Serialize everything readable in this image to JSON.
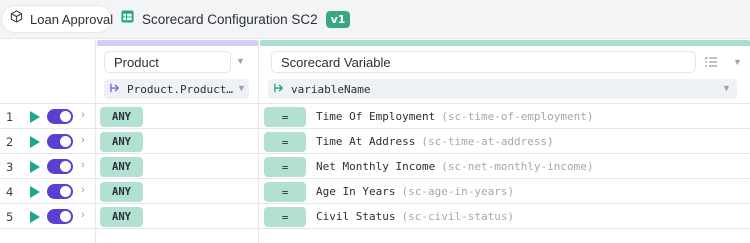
{
  "breadcrumb": {
    "project": "Loan Approval",
    "item": "Scorecard Configuration SC2",
    "version": "v1"
  },
  "colors": {
    "accent_purple": "#5b3fd1",
    "accent_green": "#1ea887",
    "chip_green": "#b2e0d3",
    "product_bar": "#d5cdf3",
    "variable_bar": "#a9decf"
  },
  "columns": {
    "product": {
      "title": "Product",
      "binding": "Product.Product…"
    },
    "variable": {
      "title": "Scorecard Variable",
      "binding": "variableName"
    }
  },
  "rows": [
    {
      "num": "1",
      "product": "ANY",
      "op": "=",
      "label": "Time Of Employment",
      "id": "(sc-time-of-employment)"
    },
    {
      "num": "2",
      "product": "ANY",
      "op": "=",
      "label": "Time At Address",
      "id": "(sc-time-at-address)"
    },
    {
      "num": "3",
      "product": "ANY",
      "op": "=",
      "label": "Net Monthly Income",
      "id": "(sc-net-monthly-income)"
    },
    {
      "num": "4",
      "product": "ANY",
      "op": "=",
      "label": "Age In Years",
      "id": "(sc-age-in-years)"
    },
    {
      "num": "5",
      "product": "ANY",
      "op": "=",
      "label": "Civil Status",
      "id": "(sc-civil-status)"
    }
  ]
}
